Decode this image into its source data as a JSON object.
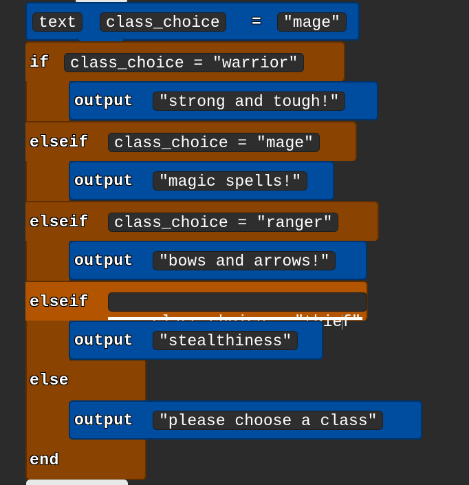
{
  "colors": {
    "background": "#2b2b2b",
    "blue_block": "#004c9e",
    "brown_block": "#8a4300",
    "brown_highlight": "#b35500",
    "pill": "#2e2e2e"
  },
  "assign": {
    "keyword": "text",
    "variable": "class_choice",
    "operator": "=",
    "value": "\"mage\""
  },
  "if_block": {
    "if_keyword": "if",
    "if_condition": "class_choice = \"warrior\"",
    "if_output_keyword": "output",
    "if_output_value": "\"strong and tough!\"",
    "branches": [
      {
        "keyword": "elseif",
        "condition": "class_choice = \"mage\"",
        "output_keyword": "output",
        "output_value": "\"magic spells!\""
      },
      {
        "keyword": "elseif",
        "condition": "class_choice = \"ranger\"",
        "output_keyword": "output",
        "output_value": "\"bows and arrows!\""
      },
      {
        "keyword": "elseif",
        "condition_before_cursor": "class_choice = \"thie",
        "condition_after_cursor": "f\"",
        "output_keyword": "output",
        "output_value": "\"stealthiness\""
      }
    ],
    "else_keyword": "else",
    "else_output_keyword": "output",
    "else_output_value": "\"please choose a class\"",
    "end_keyword": "end"
  }
}
